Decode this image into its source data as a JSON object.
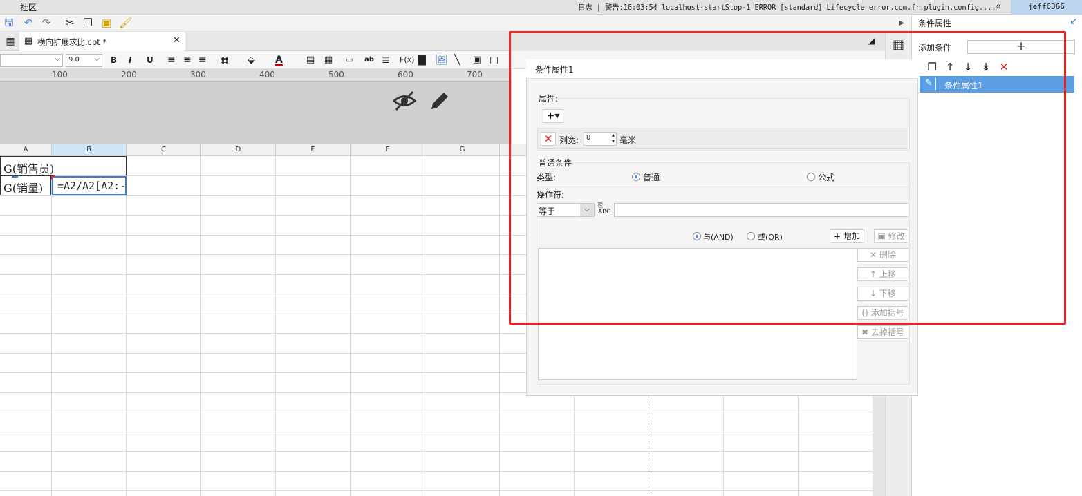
{
  "topbar": {
    "community": "社区",
    "log_text": "日志 | 警告:16:03:54 localhost-startStop-1 ERROR [standard] Lifecycle error.com.fr.plugin.config....",
    "user": "jeff6366"
  },
  "tab": {
    "name": "横向扩展求比.cpt *",
    "close": "✕"
  },
  "format": {
    "font_size": "9.0",
    "bold": "B",
    "italic": "I",
    "underline": "U"
  },
  "ruler": [
    "100",
    "200",
    "300",
    "400",
    "500",
    "600",
    "700"
  ],
  "sheet": {
    "columns": [
      "A",
      "B",
      "C",
      "D",
      "E",
      "F",
      "G"
    ],
    "cells": {
      "a1": "G(销售员)",
      "a2": "G(销量)",
      "b2": "=A2/A2[A2:-"
    }
  },
  "right_panel": {
    "title": "条件属性",
    "add_condition": "添加条件",
    "add_symbol": "+",
    "item": "条件属性1"
  },
  "dialog": {
    "title": "条件属性1",
    "attr_label": "属性:",
    "col_width_label": "列宽:",
    "col_width_value": "0",
    "unit": "毫米",
    "common_cond": "普通条件",
    "type_label": "类型:",
    "type_normal": "普通",
    "type_formula": "公式",
    "operator_label": "操作符:",
    "operator_value": "等于",
    "and_label": "与(AND)",
    "or_label": "或(OR)",
    "add_btn": "增加",
    "modify_btn": "修改",
    "delete_btn": "删除",
    "up_btn": "上移",
    "down_btn": "下移",
    "add_paren_btn": "添加括号",
    "remove_paren_btn": "去掉括号"
  }
}
